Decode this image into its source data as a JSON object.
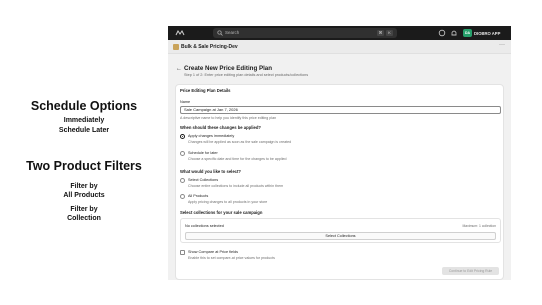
{
  "promo": {
    "heading1": "Schedule Options",
    "item1": "Immediately",
    "item2": "Schedule Later",
    "heading2": "Two Product Filters",
    "item3_line1": "Filter by",
    "item3_line2": "All Products",
    "item4_line1": "Filter by",
    "item4_line2": "Collection"
  },
  "topbar": {
    "search_placeholder": "Search",
    "shortcut_1": "⌘",
    "shortcut_2": "K",
    "store_initials": "DA",
    "store_name": "DIOBRO APP"
  },
  "appbar": {
    "title": "Bulk & Sale Pricing-Dev",
    "more": "···"
  },
  "page": {
    "back": "←",
    "title": "Create New Price Editing Plan",
    "subtitle": "Step 1 of 2: Enter price editing plan details and select products/collections"
  },
  "form": {
    "section_title": "Price Editing Plan Details",
    "name_label": "Name",
    "name_value": "Sale Campaign at Jan 7, 2026",
    "name_help": "A descriptive name to help you identify this price editing plan",
    "when_label": "When should these changes be applied?",
    "opt_immediate": "Apply changes immediately",
    "opt_immediate_help": "Changes will be applied as soon as the sale campaign is created",
    "opt_later": "Schedule for later",
    "opt_later_help": "Choose a specific date and time for the changes to be applied",
    "select_label": "What would you like to select?",
    "opt_collections": "Select Collections",
    "opt_collections_help": "Choose entire collections to include all products within them",
    "opt_all": "All Products",
    "opt_all_help": "Apply pricing changes to all products in your store",
    "collections_label": "Select collections for your sale campaign",
    "no_collections": "No collections selected",
    "max_note": "Maximum: 1 collection",
    "select_collections_btn": "Select Collections",
    "compare_label": "Show Compare at Price fields",
    "compare_help": "Enable this to set compare-at price values for products",
    "continue_btn": "Continue to Edit Pricing Rule"
  },
  "colors": {
    "topbar": "#1b1b1b",
    "store_badge": "#26a06b",
    "app_bg": "#f1f1f1"
  }
}
